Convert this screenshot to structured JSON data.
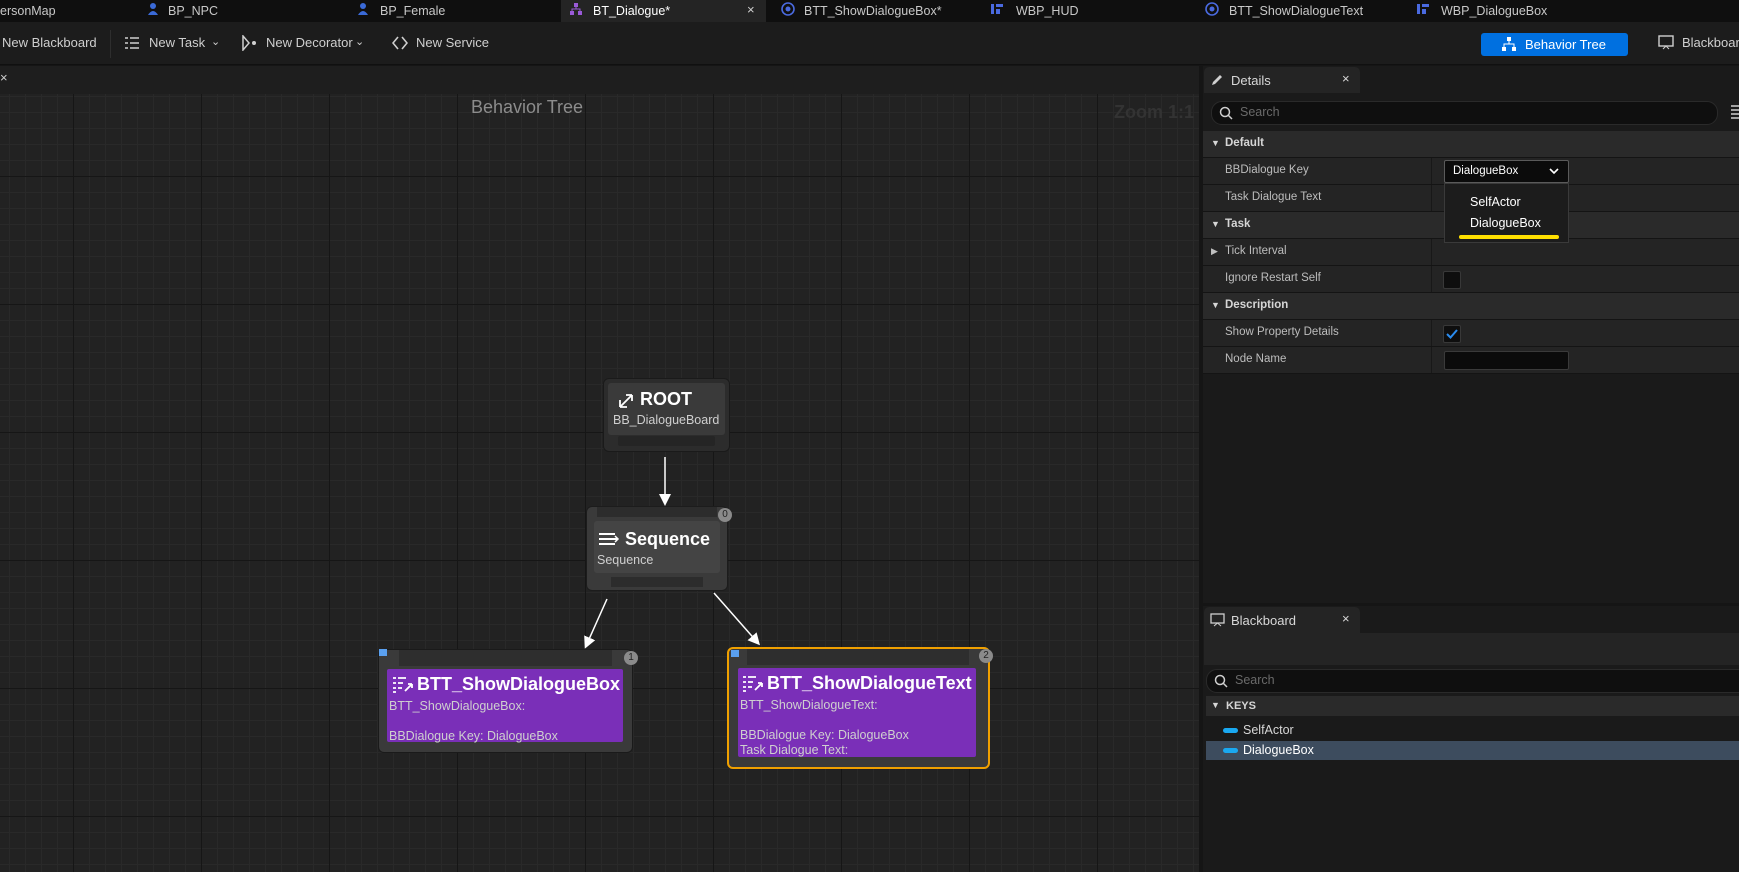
{
  "tabs": [
    {
      "label": "ersonMap"
    },
    {
      "label": "BP_NPC"
    },
    {
      "label": "BP_Female"
    },
    {
      "label": "BT_Dialogue*"
    },
    {
      "label": "BTT_ShowDialogueBox*"
    },
    {
      "label": "WBP_HUD"
    },
    {
      "label": "BTT_ShowDialogueText"
    },
    {
      "label": "WBP_DialogueBox"
    }
  ],
  "toolbar": {
    "new_blackboard": "New Blackboard",
    "new_task": "New Task",
    "new_decorator": "New Decorator",
    "new_service": "New Service",
    "behavior_tree": "Behavior Tree",
    "blackboard": "Blackboard"
  },
  "graph": {
    "title": "Behavior Tree",
    "zoom": "Zoom 1:1",
    "nodes": {
      "root": {
        "title": "ROOT",
        "subtitle": "BB_DialogueBoard"
      },
      "sequence": {
        "title": "Sequence",
        "subtitle": "Sequence",
        "badge": "0"
      },
      "task1": {
        "title": "BTT_ShowDialogueBox",
        "line1": "BTT_ShowDialogueBox:",
        "line2": "BBDialogue Key: DialogueBox",
        "badge": "1"
      },
      "task2": {
        "title": "BTT_ShowDialogueText",
        "line1": "BTT_ShowDialogueText:",
        "line2": "BBDialogue Key: DialogueBox",
        "line3": "Task Dialogue Text:",
        "badge": "2"
      }
    }
  },
  "details": {
    "tab": "Details",
    "search_placeholder": "Search",
    "cat_default": "Default",
    "bb_key_label": "BBDialogue Key",
    "bb_key_value": "DialogueBox",
    "task_text_label": "Task Dialogue Text",
    "cat_task": "Task",
    "tick_interval": "Tick Interval",
    "ignore_restart": "Ignore Restart Self",
    "cat_description": "Description",
    "show_property_details": "Show Property Details",
    "show_property_checked": true,
    "node_name": "Node Name",
    "dropdown_options": [
      "SelfActor",
      "DialogueBox"
    ],
    "dropdown_selected": "DialogueBox"
  },
  "blackboard": {
    "tab": "Blackboard",
    "search_placeholder": "Search",
    "keys_header": "KEYS",
    "keys": [
      {
        "name": "SelfActor",
        "selected": false
      },
      {
        "name": "DialogueBox",
        "selected": true
      }
    ]
  },
  "colors": {
    "accent_blue": "#0070e0",
    "task_purple": "#7a2fb8",
    "selected_orange": "#f0a000",
    "key_blue": "#1aa8f0"
  }
}
